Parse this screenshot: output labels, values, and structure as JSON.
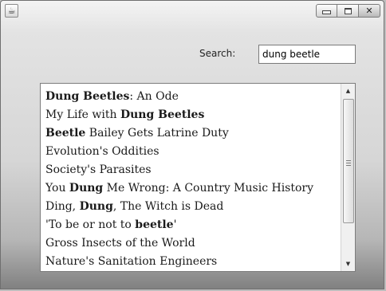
{
  "window": {
    "icon": "java-app-icon",
    "controls": {
      "minimize": "minimize-icon",
      "maximize": "maximize-icon",
      "close": "✕"
    }
  },
  "search": {
    "label": "Search:",
    "value": "dung beetle"
  },
  "results": [
    [
      {
        "t": "Dung Beetles",
        "b": true
      },
      {
        "t": ": An Ode",
        "b": false
      }
    ],
    [
      {
        "t": "My Life with ",
        "b": false
      },
      {
        "t": "Dung Beetles",
        "b": true
      }
    ],
    [
      {
        "t": "Beetle",
        "b": true
      },
      {
        "t": " Bailey Gets Latrine Duty",
        "b": false
      }
    ],
    [
      {
        "t": "Evolution's Oddities",
        "b": false
      }
    ],
    [
      {
        "t": "Society's Parasites",
        "b": false
      }
    ],
    [
      {
        "t": "You ",
        "b": false
      },
      {
        "t": "Dung",
        "b": true
      },
      {
        "t": " Me Wrong: A Country Music History",
        "b": false
      }
    ],
    [
      {
        "t": "Ding, ",
        "b": false
      },
      {
        "t": "Dung",
        "b": true
      },
      {
        "t": ", The Witch is Dead",
        "b": false
      }
    ],
    [
      {
        "t": "'To be or not to ",
        "b": false
      },
      {
        "t": "beetle",
        "b": true
      },
      {
        "t": "'",
        "b": false
      }
    ],
    [
      {
        "t": "Gross Insects of the World",
        "b": false
      }
    ],
    [
      {
        "t": "Nature's Sanitation Engineers",
        "b": false
      }
    ]
  ],
  "scrollbar": {
    "up": "▲",
    "down": "▼",
    "position": 0.0
  }
}
